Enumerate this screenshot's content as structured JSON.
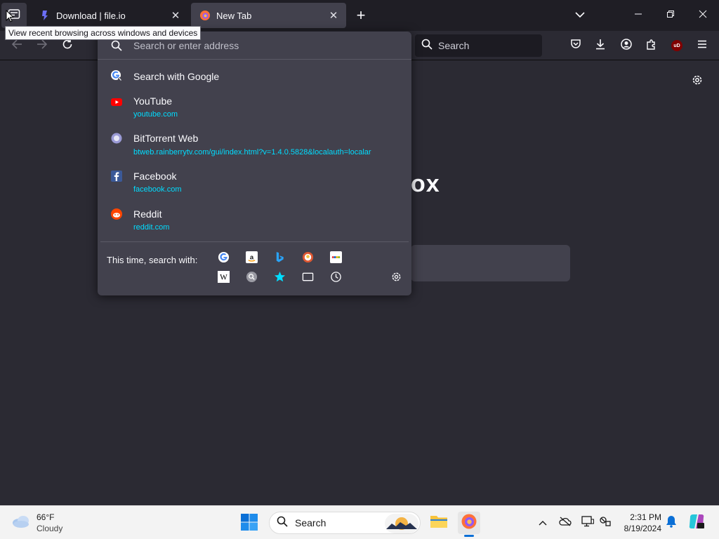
{
  "tabs": [
    {
      "title": "Download | file.io",
      "close_label": "✕"
    },
    {
      "title": "New Tab",
      "close_label": "✕"
    }
  ],
  "new_tab_label": "+",
  "toolbar": {
    "search_label": "Search",
    "shield_badge": "uD"
  },
  "brand_partial": "ox",
  "urlbar": {
    "placeholder": "Search or enter address",
    "results": [
      {
        "icon": "google-icon",
        "title": "Search with Google",
        "url": ""
      },
      {
        "icon": "youtube-icon",
        "title": "YouTube",
        "url": "youtube.com"
      },
      {
        "icon": "bittorrent-icon",
        "title": "BitTorrent Web",
        "url": "btweb.rainberrytv.com/gui/index.html?v=1.4.0.5828&localauth=localar"
      },
      {
        "icon": "facebook-icon",
        "title": "Facebook",
        "url": "facebook.com"
      },
      {
        "icon": "reddit-icon",
        "title": "Reddit",
        "url": "reddit.com"
      }
    ],
    "oneoff_label": "This time, search with:",
    "engines": [
      "google-icon",
      "amazon-icon",
      "bing-icon",
      "duckduckgo-icon",
      "ebay-icon",
      "wikipedia-icon",
      "search-engine-icon",
      "bookmarks-star-icon",
      "tabs-icon",
      "history-icon"
    ]
  },
  "tooltip": "View recent browsing across windows and devices",
  "taskbar": {
    "weather_temp": "66°F",
    "weather_desc": "Cloudy",
    "search_label": "Search",
    "time": "2:31 PM",
    "date": "8/19/2024"
  },
  "colors": {
    "accent": "#00ddff",
    "tab_active": "#42414d",
    "toolbar": "#2b2a33"
  }
}
